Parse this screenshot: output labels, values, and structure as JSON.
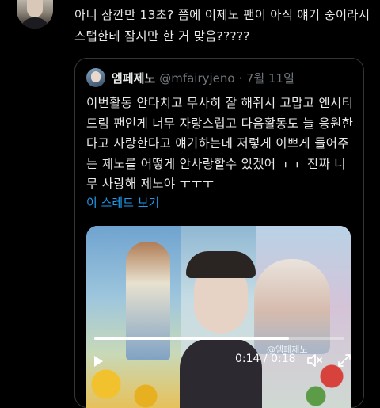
{
  "tweet": {
    "text": "아니 잠깐만 13초? 쯤에 이제노 팬이 아직 얘기 중이라서 스탭한테 잠시만 한 거 맞음?????"
  },
  "quote": {
    "name": "엠페제노",
    "handle_date": "@mfairyjeno · 7월 11일",
    "body": "이번활동 안다치고 무사히 잘 해줘서 고맙고 엔시티드림 팬인게 너무 자랑스럽고 다음활동도 늘 응원한다고 사랑한다고 얘기하는데 저렇게 이쁘게 들어주는 제노를 어떻게 안사랑할수 있겠어 ㅜㅜ 진짜 너무 사랑해 제노야 ㅜㅜㅜ",
    "thread_link": "이 스레드 보기"
  },
  "video": {
    "watermark": "@엠페제노",
    "current_time": "0:14",
    "separator": "/",
    "duration": "0:18",
    "progress": 0.78
  },
  "icons": {
    "play": "play-icon",
    "volume": "volume-icon",
    "fullscreen": "fullscreen-icon"
  }
}
